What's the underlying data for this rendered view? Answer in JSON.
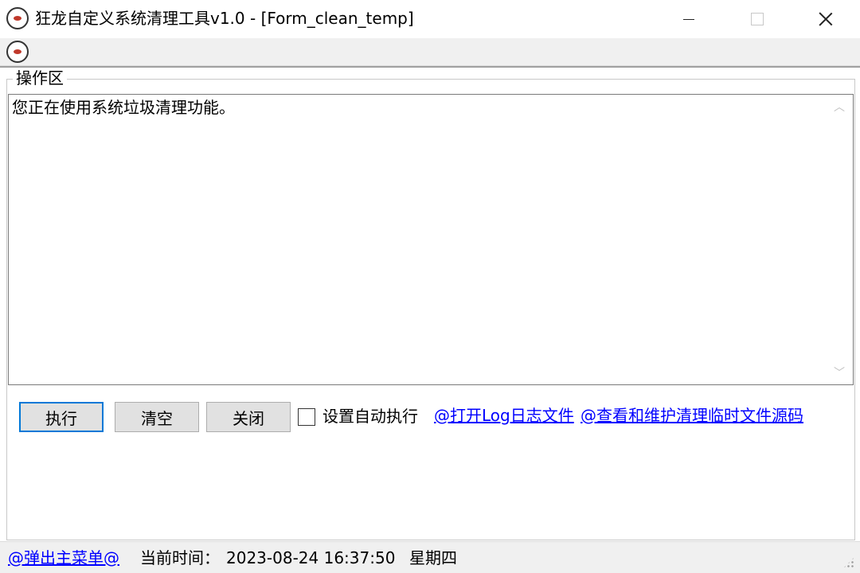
{
  "window": {
    "title": "狂龙自定义系统清理工具v1.0 - [Form_clean_temp]",
    "app_icon": "app-logo-icon",
    "controls": {
      "minimize_icon": "minimize-icon",
      "maximize_icon": "maximize-icon",
      "close_icon": "close-icon"
    }
  },
  "menustrip": {
    "icon": "app-logo-icon"
  },
  "group": {
    "legend": "操作区"
  },
  "output": {
    "text": "您正在使用系统垃圾清理功能。"
  },
  "actions": {
    "execute_label": "执行",
    "clear_label": "清空",
    "close_label": "关闭",
    "auto_exec_label": "设置自动执行",
    "auto_exec_checked": false,
    "open_log_link": "@打开Log日志文件",
    "view_source_link": "@查看和维护清理临时文件源码"
  },
  "status": {
    "main_menu_link": "@弹出主菜单@",
    "time_label": "当前时间：",
    "time_value": "2023-08-24 16:37:50",
    "weekday": "星期四"
  },
  "colors": {
    "link": "#0000ff",
    "focus_border": "#0078d7",
    "window_bg": "#f0f0f0"
  }
}
